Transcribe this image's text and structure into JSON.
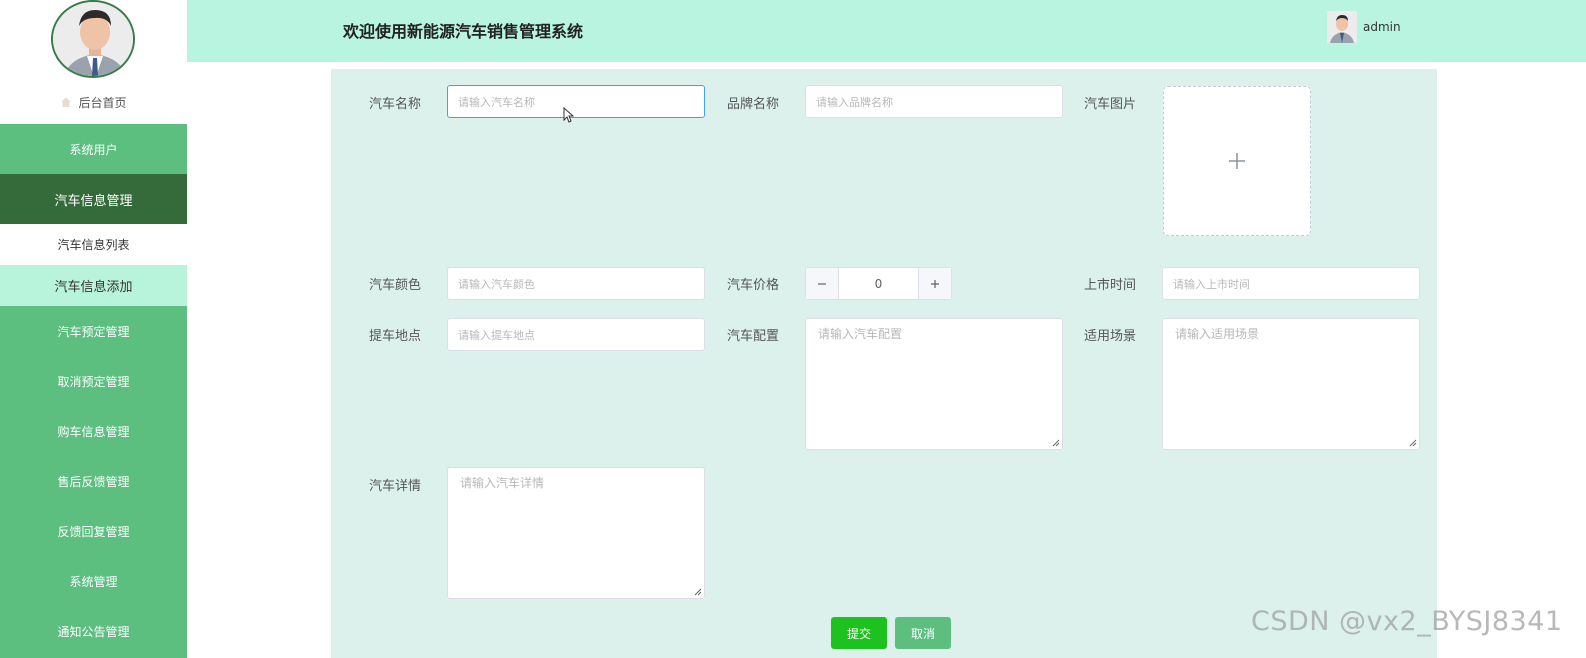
{
  "app": {
    "title": "欢迎使用新能源汽车销售管理系统"
  },
  "user": {
    "name": "admin"
  },
  "sidebar": {
    "home_label": "后台首页",
    "items": [
      {
        "label": "系统用户"
      },
      {
        "label": "汽车信息管理"
      },
      {
        "label": "汽车信息列表"
      },
      {
        "label": "汽车信息添加"
      },
      {
        "label": "汽车预定管理"
      },
      {
        "label": "取消预定管理"
      },
      {
        "label": "购车信息管理"
      },
      {
        "label": "售后反馈管理"
      },
      {
        "label": "反馈回复管理"
      },
      {
        "label": "系统管理"
      },
      {
        "label": "通知公告管理"
      }
    ]
  },
  "form": {
    "car_name": {
      "label": "汽车名称",
      "placeholder": "请输入汽车名称"
    },
    "brand_name": {
      "label": "品牌名称",
      "placeholder": "请输入品牌名称"
    },
    "car_image": {
      "label": "汽车图片"
    },
    "car_color": {
      "label": "汽车颜色",
      "placeholder": "请输入汽车颜色"
    },
    "car_price": {
      "label": "汽车价格",
      "value": "0"
    },
    "launch_time": {
      "label": "上市时间",
      "placeholder": "请输入上市时间"
    },
    "pickup_location": {
      "label": "提车地点",
      "placeholder": "请输入提车地点"
    },
    "car_config": {
      "label": "汽车配置",
      "placeholder": "请输入汽车配置"
    },
    "scenario": {
      "label": "适用场景",
      "placeholder": "请输入适用场景"
    },
    "car_detail": {
      "label": "汽车详情",
      "placeholder": "请输入汽车详情"
    },
    "submit_label": "提交",
    "cancel_label": "取消"
  },
  "watermark": "CSDN @vx2_BYSJ8341",
  "colors": {
    "sidebar": "#5cbf80",
    "sidebar_active": "#356b3a",
    "header": "#b8f4e0",
    "panel": "#dcf1ec",
    "submit": "#1ec21e"
  }
}
